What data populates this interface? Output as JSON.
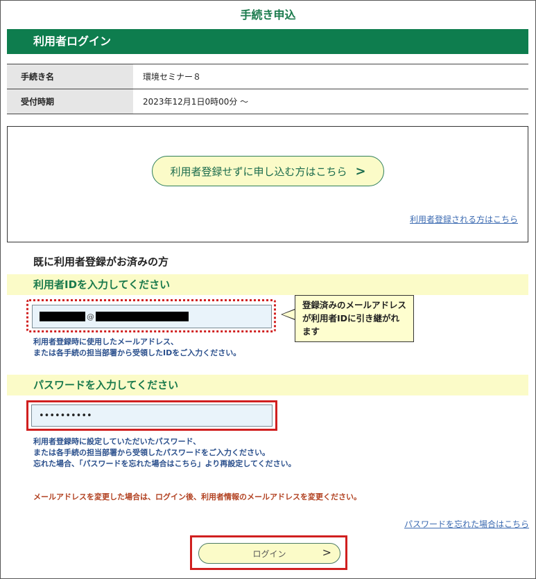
{
  "header": {
    "title": "手続き申込"
  },
  "login_bar": {
    "label": "利用者ログイン"
  },
  "info": {
    "rows": [
      {
        "label": "手続き名",
        "value": "環境セミナー８"
      },
      {
        "label": "受付時期",
        "value": "2023年12月1日0時00分 ～"
      }
    ]
  },
  "guest": {
    "button_label": "利用者登録せずに申し込む方はこちら",
    "chevron": ">",
    "register_link": "利用者登録される方はこちら"
  },
  "registered": {
    "section_title": "既に利用者登録がお済みの方",
    "id_title": "利用者IDを入力してください",
    "id_at": "@",
    "id_hint_1": "利用者登録時に使用したメールアドレス、",
    "id_hint_2": "または各手続の担当部署から受領したIDをご入力ください。",
    "callout": "登録済みのメールアドレスが利用者IDに引き継がれます",
    "pw_title": "パスワードを入力してください",
    "pw_value": "••••••••••",
    "pw_hint_1": "利用者登録時に設定していただいたパスワード、",
    "pw_hint_2": "または各手続の担当部署から受領したパスワードをご入力ください。",
    "pw_hint_3": "忘れた場合、「パスワードを忘れた場合はこちら」より再設定してください。",
    "warning": "メールアドレスを変更した場合は、ログイン後、利用者情報のメールアドレスを変更ください。",
    "forgot_link": "パスワードを忘れた場合はこちら",
    "login_label": "ログイン",
    "login_chevron": ">"
  },
  "colors": {
    "brand_green": "#0e7d4e",
    "band_yellow": "#fbfbc8",
    "highlight_red": "#d01f1f",
    "link_blue": "#3b6ab1"
  }
}
